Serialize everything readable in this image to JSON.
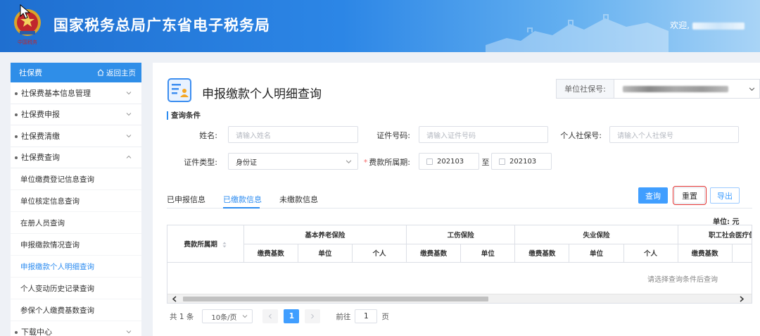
{
  "header": {
    "site_title": "国家税务总局广东省电子税务局",
    "welcome": "欢迎,",
    "emblem_caption": "中国税务"
  },
  "sidebar": {
    "title": "社保费",
    "home_link": "返回主页",
    "groups": [
      {
        "label": "社保费基本信息管理"
      },
      {
        "label": "社保费申报"
      },
      {
        "label": "社保费清缴"
      },
      {
        "label": "社保费查询"
      }
    ],
    "sub_items": [
      {
        "label": "单位缴费登记信息查询"
      },
      {
        "label": "单位核定信息查询"
      },
      {
        "label": "在册人员查询"
      },
      {
        "label": "申报缴款情况查询"
      },
      {
        "label": "申报缴款个人明细查询"
      },
      {
        "label": "个人变动历史记录查询"
      },
      {
        "label": "参保个人缴费基数查询"
      }
    ],
    "last_group": {
      "label": "下载中心"
    }
  },
  "main": {
    "page_title": "申报缴款个人明细查询",
    "unit_social_label": "单位社保号:",
    "condition_title": "查询条件",
    "fields": {
      "name_label": "姓名:",
      "name_placeholder": "请输入姓名",
      "id_number_label": "证件号码:",
      "id_number_placeholder": "请输入证件号码",
      "personal_social_label": "个人社保号:",
      "personal_social_placeholder": "请输入个人社保号",
      "id_type_label": "证件类型:",
      "id_type_value": "身份证",
      "period_label": "费款所属期:",
      "period_from": "202103",
      "period_sep": "至",
      "period_to": "202103"
    },
    "tabs": [
      {
        "label": "已申报信息"
      },
      {
        "label": "已缴款信息"
      },
      {
        "label": "未缴款信息"
      }
    ],
    "buttons": {
      "query": "查询",
      "reset": "重置",
      "export": "导出"
    },
    "unit_note": "单位: 元",
    "table": {
      "period_header": "费款所属期",
      "groups": [
        {
          "label": "基本养老保险",
          "cols": [
            "缴费基数",
            "单位",
            "个人"
          ]
        },
        {
          "label": "工伤保险",
          "cols": [
            "缴费基数",
            "单位"
          ]
        },
        {
          "label": "失业保险",
          "cols": [
            "缴费基数",
            "单位",
            "个人"
          ]
        },
        {
          "label": "职工社会医疗保",
          "cols": [
            "缴费基数",
            "单位"
          ]
        }
      ],
      "empty_text": "请选择查询条件后查询"
    },
    "pager": {
      "total": "共 1 条",
      "page_size": "10条/页",
      "current_page": "1",
      "goto_label": "前往",
      "goto_value": "1",
      "page_suffix": "页"
    }
  },
  "colors": {
    "primary": "#409eff",
    "header_start": "#1f6fd0",
    "reset_outline": "#e03030"
  }
}
